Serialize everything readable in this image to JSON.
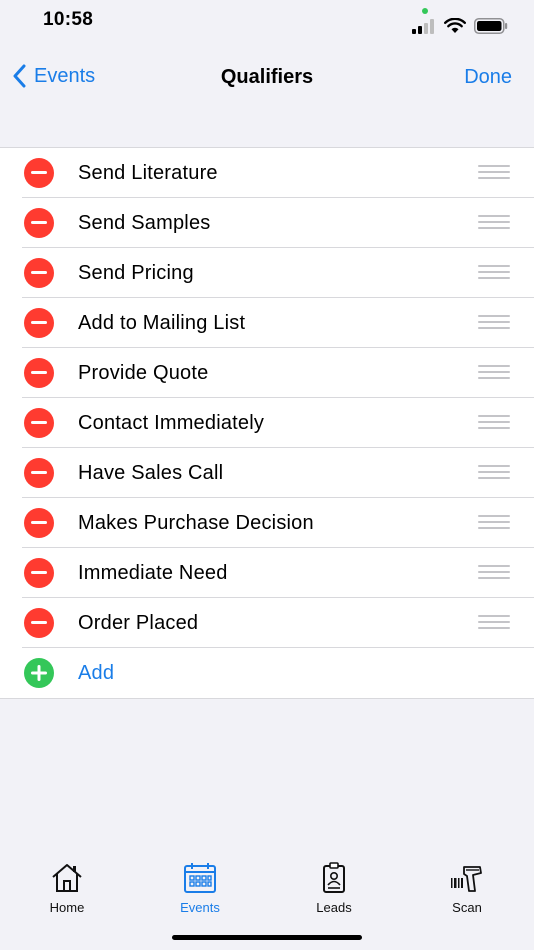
{
  "status": {
    "time": "10:58"
  },
  "nav": {
    "back_label": "Events",
    "title": "Qualifiers",
    "done_label": "Done"
  },
  "qualifiers": [
    {
      "label": "Send Literature"
    },
    {
      "label": "Send Samples"
    },
    {
      "label": "Send Pricing"
    },
    {
      "label": "Add to Mailing List"
    },
    {
      "label": "Provide Quote"
    },
    {
      "label": "Contact Immediately"
    },
    {
      "label": "Have Sales Call"
    },
    {
      "label": "Makes Purchase Decision"
    },
    {
      "label": "Immediate Need"
    },
    {
      "label": "Order Placed"
    }
  ],
  "add_label": "Add",
  "tabs": [
    {
      "label": "Home",
      "icon": "house-icon"
    },
    {
      "label": "Events",
      "icon": "calendar-icon"
    },
    {
      "label": "Leads",
      "icon": "badge-icon"
    },
    {
      "label": "Scan",
      "icon": "scanner-icon"
    }
  ],
  "colors": {
    "accent": "#1a7de8",
    "remove": "#ff3b30",
    "add": "#34c759",
    "background": "#f2f2f7"
  }
}
